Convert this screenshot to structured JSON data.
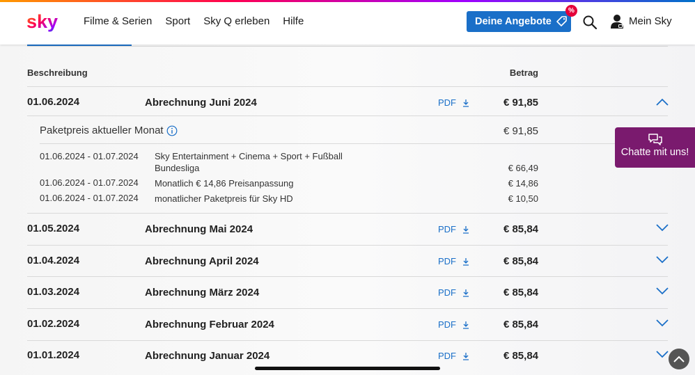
{
  "header": {
    "logo": "sky",
    "nav": [
      "Filme & Serien",
      "Sport",
      "Sky Q erleben",
      "Hilfe"
    ],
    "offers_button": "Deine Angebote",
    "offers_badge": "%",
    "account_label": "Mein Sky"
  },
  "table": {
    "col_description": "Beschreibung",
    "col_amount": "Betrag"
  },
  "expanded": {
    "date": "01.06.2024",
    "title": "Abrechnung Juni 2024",
    "pdf": "PDF",
    "amount": "€ 91,85",
    "package_label": "Paketpreis aktueller Monat",
    "package_amount": "€ 91,85",
    "items": [
      {
        "period": "01.06.2024 - 01.07.2024",
        "desc": "Sky Entertainment + Cinema + Sport + Fußball Bundesliga",
        "amount": "€ 66,49"
      },
      {
        "period": "01.06.2024 - 01.07.2024",
        "desc": "Monatlich € 14,86 Preisanpassung",
        "amount": "€ 14,86"
      },
      {
        "period": "01.06.2024 - 01.07.2024",
        "desc": "monatlicher Paketpreis für Sky HD",
        "amount": "€ 10,50"
      }
    ]
  },
  "rows": [
    {
      "date": "01.05.2024",
      "title": "Abrechnung Mai 2024",
      "pdf": "PDF",
      "amount": "€ 85,84"
    },
    {
      "date": "01.04.2024",
      "title": "Abrechnung April 2024",
      "pdf": "PDF",
      "amount": "€ 85,84"
    },
    {
      "date": "01.03.2024",
      "title": "Abrechnung März 2024",
      "pdf": "PDF",
      "amount": "€ 85,84"
    },
    {
      "date": "01.02.2024",
      "title": "Abrechnung Februar 2024",
      "pdf": "PDF",
      "amount": "€ 85,84"
    },
    {
      "date": "01.01.2024",
      "title": "Abrechnung Januar 2024",
      "pdf": "PDF",
      "amount": "€ 85,84"
    }
  ],
  "chat": {
    "label": "Chatte mit uns!"
  },
  "colors": {
    "accent": "#1a6fc8",
    "chat": "#7a1a6e",
    "badge": "#e4003a"
  }
}
